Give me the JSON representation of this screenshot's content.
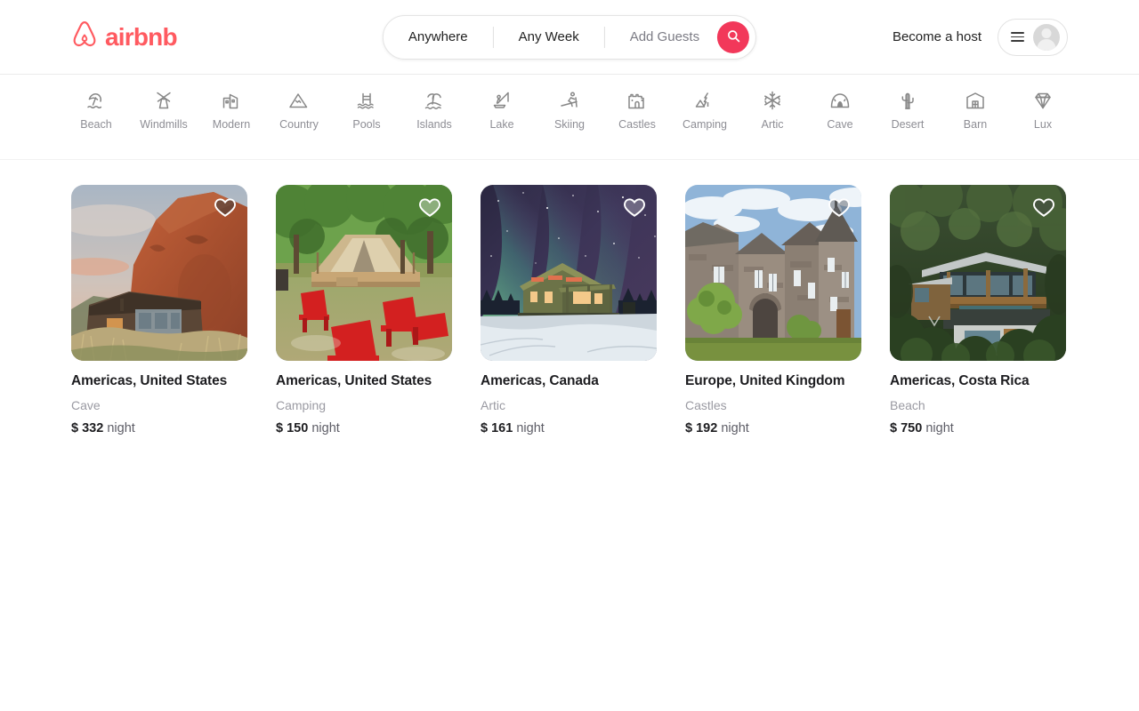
{
  "brand": {
    "name": "airbnb",
    "logo_icon": "airbnb-belo-icon",
    "color": "#ff5a60"
  },
  "header": {
    "search": {
      "location_label": "Anywhere",
      "dates_label": "Any Week",
      "guests_label": "Add Guests",
      "search_icon": "search-icon",
      "search_button_color": "#f2385a"
    },
    "become_host_label": "Become a host",
    "menu_icon": "hamburger-menu-icon",
    "avatar_icon": "user-avatar-icon"
  },
  "categories": [
    {
      "label": "Beach",
      "icon": "beach-umbrella-icon",
      "glyph": "⛱"
    },
    {
      "label": "Windmills",
      "icon": "windmill-icon",
      "glyph": "🌫"
    },
    {
      "label": "Modern",
      "icon": "modern-building-icon",
      "glyph": "🏢"
    },
    {
      "label": "Country",
      "icon": "mountain-country-icon",
      "glyph": "⛰"
    },
    {
      "label": "Pools",
      "icon": "pool-ladder-icon",
      "glyph": "🏊"
    },
    {
      "label": "Islands",
      "icon": "palm-island-icon",
      "glyph": "🏝"
    },
    {
      "label": "Lake",
      "icon": "fishing-lake-icon",
      "glyph": "🎣"
    },
    {
      "label": "Skiing",
      "icon": "skier-icon",
      "glyph": "⛷"
    },
    {
      "label": "Castles",
      "icon": "castle-icon",
      "glyph": "🏰"
    },
    {
      "label": "Camping",
      "icon": "tent-camping-icon",
      "glyph": "⛺"
    },
    {
      "label": "Artic",
      "icon": "snowflake-icon",
      "glyph": "❄"
    },
    {
      "label": "Cave",
      "icon": "cave-icon",
      "glyph": "🕳"
    },
    {
      "label": "Desert",
      "icon": "cactus-icon",
      "glyph": "🌵"
    },
    {
      "label": "Barn",
      "icon": "barn-icon",
      "glyph": "🏚"
    },
    {
      "label": "Lux",
      "icon": "diamond-icon",
      "glyph": "💎"
    }
  ],
  "listings": [
    {
      "title": "Americas, United States",
      "category": "Cave",
      "currency": "$",
      "price": "332",
      "period": "night",
      "favorite_icon": "heart-icon",
      "image_alt": "cave-cliff-dwelling-photo"
    },
    {
      "title": "Americas, United States",
      "category": "Camping",
      "currency": "$",
      "price": "150",
      "period": "night",
      "favorite_icon": "heart-icon",
      "image_alt": "glamping-tent-red-chairs-photo"
    },
    {
      "title": "Americas, Canada",
      "category": "Artic",
      "currency": "$",
      "price": "161",
      "period": "night",
      "favorite_icon": "heart-icon",
      "image_alt": "aurora-cabin-snow-photo"
    },
    {
      "title": "Europe, United Kingdom",
      "category": "Castles",
      "currency": "$",
      "price": "192",
      "period": "night",
      "favorite_icon": "heart-icon",
      "image_alt": "stone-castle-turret-photo"
    },
    {
      "title": "Americas, Costa Rica",
      "category": "Beach",
      "currency": "$",
      "price": "750",
      "period": "night",
      "favorite_icon": "heart-icon",
      "image_alt": "jungle-modern-villa-photo"
    }
  ]
}
